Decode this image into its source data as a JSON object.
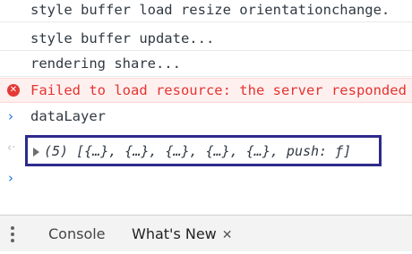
{
  "console": {
    "lines": [
      {
        "text": "style buffer load resize orientationchange.",
        "kind": "log"
      },
      {
        "text": "style buffer update...",
        "kind": "log"
      },
      {
        "text": "rendering share...",
        "kind": "log"
      },
      {
        "text": "Failed to load resource: the server responded",
        "kind": "error"
      },
      {
        "text": "dataLayer",
        "kind": "input"
      }
    ],
    "error_icon_glyph": "✕",
    "input_prompt": "›",
    "result_arrow": "‹·",
    "result_value": "(5) [{…}, {…}, {…}, {…}, {…}, push: ƒ]",
    "empty_prompt": "›"
  },
  "drawer": {
    "tabs": [
      {
        "label": "Console"
      },
      {
        "label": "What's New",
        "close": "✕"
      }
    ]
  }
}
